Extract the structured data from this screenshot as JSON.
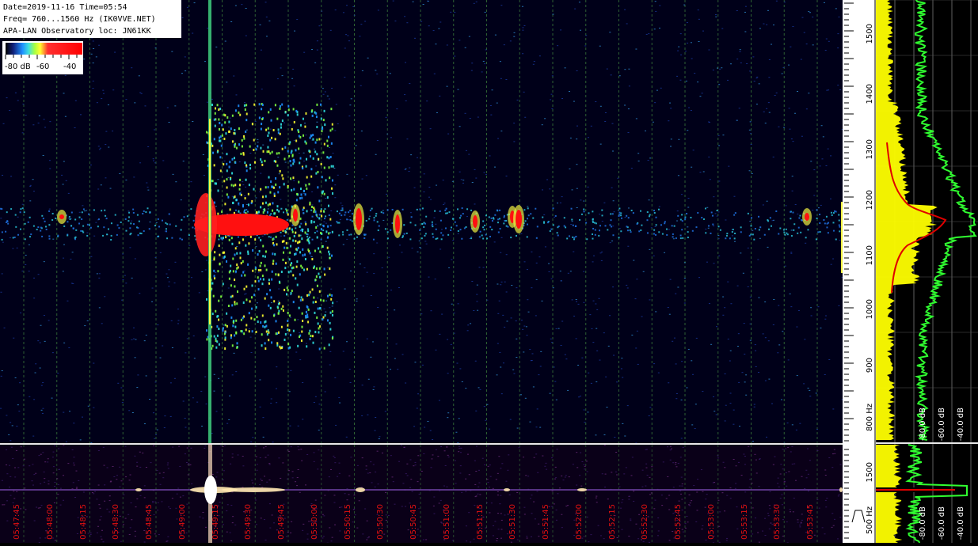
{
  "header": {
    "line1": "Date=2019-11-16 Time=05:54",
    "line2": "Freq= 760...1560 Hz (IK0VVE.NET)",
    "line3": "APA-LAN Observatory loc: JN61KK"
  },
  "colorbar": {
    "labels": [
      "-80 dB",
      "-60",
      "-40"
    ]
  },
  "freq_axis": {
    "top_labels": [
      "1500",
      "1400",
      "1300",
      "1200",
      "1100",
      "1000",
      "900",
      "800 Hz"
    ],
    "bottom_labels": [
      "1500",
      "500 Hz"
    ]
  },
  "db_axis": {
    "top_labels": [
      "-80.0 dB",
      "-60.0 dB",
      "-40.0 dB"
    ],
    "bottom_labels": [
      "-80.0 dB",
      "-60.0 dB",
      "-40.0 dB"
    ]
  },
  "time_labels": [
    "05:47:45",
    "05:48:00",
    "05:48:15",
    "05:48:30",
    "05:48:45",
    "05:49:00",
    "05:49:15",
    "05:49:30",
    "05:49:45",
    "05:50:00",
    "05:50:15",
    "05:50:30",
    "05:50:45",
    "05:51:00",
    "05:51:15",
    "05:51:30",
    "05:51:45",
    "05:52:00",
    "05:52:15",
    "05:52:30",
    "05:52:45",
    "05:53:00",
    "05:53:15",
    "05:53:30",
    "05:53:45"
  ],
  "colors": {
    "background": "#000019",
    "grid": "#3a7a3a",
    "time_label": "#e01010",
    "trace_yellow": "#ffff00",
    "trace_green": "#30ff30",
    "trace_red": "#e00000"
  }
}
